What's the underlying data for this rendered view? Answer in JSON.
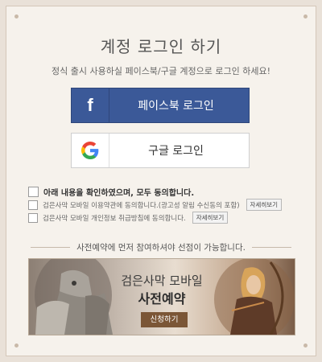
{
  "header": {
    "title": "계정 로그인 하기",
    "subtitle": "정식 출시 사용하실 페이스북/구글 계정으로 로그인 하세요!"
  },
  "login": {
    "facebook_label": "페이스북 로그인",
    "facebook_icon_glyph": "f",
    "google_label": "구글 로그인",
    "facebook_color": "#3b5998"
  },
  "agreements": {
    "all_label": "아래 내용을 확인하였으며, 모두 동의합니다.",
    "items": [
      {
        "label": "검은사막 모바일 이용약관에 동의합니다.(광고성 알림 수신동의 포함)",
        "detail_label": "자세히보기"
      },
      {
        "label": "검은사막 모바일 개인정보 취급방침에 동의합니다.",
        "detail_label": "자세히보기"
      }
    ]
  },
  "notice": {
    "text": "사전예약에 먼저 참여하셔야 선점이 가능합니다."
  },
  "banner": {
    "title": "검은사막 모바일",
    "subtitle": "사전예약",
    "button_label": "신청하기",
    "button_color": "#7b5636"
  }
}
